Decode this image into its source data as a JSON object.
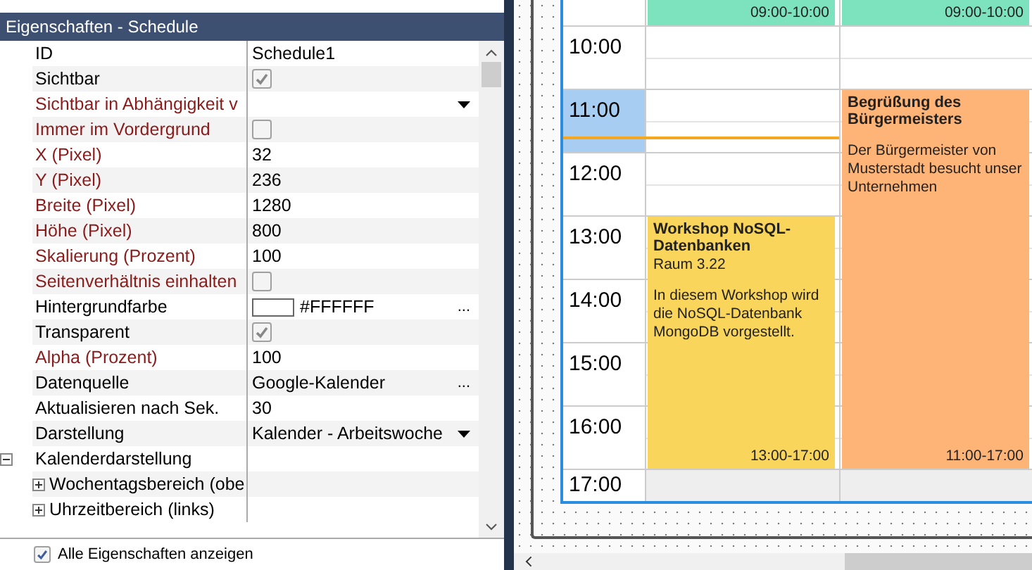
{
  "panel": {
    "title": "Eigenschaften - Schedule",
    "properties": [
      {
        "label": "ID",
        "modified": false,
        "kind": "text",
        "value": "Schedule1"
      },
      {
        "label": "Sichtbar",
        "modified": false,
        "kind": "checkbox",
        "checked": true
      },
      {
        "label": "Sichtbar in Abhängigkeit v",
        "modified": true,
        "kind": "dropdown"
      },
      {
        "label": "Immer im Vordergrund",
        "modified": true,
        "kind": "checkbox",
        "checked": false
      },
      {
        "label": "X (Pixel)",
        "modified": true,
        "kind": "text",
        "value": "32"
      },
      {
        "label": "Y (Pixel)",
        "modified": true,
        "kind": "text",
        "value": "236"
      },
      {
        "label": "Breite (Pixel)",
        "modified": true,
        "kind": "text",
        "value": "1280"
      },
      {
        "label": "Höhe (Pixel)",
        "modified": true,
        "kind": "text",
        "value": "800"
      },
      {
        "label": "Skalierung (Prozent)",
        "modified": true,
        "kind": "text",
        "value": "100"
      },
      {
        "label": "Seitenverhältnis einhalten",
        "modified": true,
        "kind": "checkbox",
        "checked": false
      },
      {
        "label": "Hintergrundfarbe",
        "modified": false,
        "kind": "color",
        "color": "#ffffff",
        "value": "#FFFFFF",
        "button": "..."
      },
      {
        "label": "Transparent",
        "modified": false,
        "kind": "checkbox",
        "checked": true
      },
      {
        "label": "Alpha (Prozent)",
        "modified": true,
        "kind": "text",
        "value": "100"
      },
      {
        "label": "Datenquelle",
        "modified": false,
        "kind": "picker",
        "value": "Google-Kalender",
        "button": "..."
      },
      {
        "label": "Aktualisieren nach Sek.",
        "modified": false,
        "kind": "text",
        "value": "30"
      },
      {
        "label": "Darstellung",
        "modified": false,
        "kind": "dropdown",
        "value": "Kalender - Arbeitswoche"
      },
      {
        "label": "Kalenderdarstellung",
        "modified": false,
        "kind": "group",
        "expanded": true,
        "children": [
          {
            "label": "Wochentagsbereich (obe",
            "modified": false,
            "kind": "group",
            "expanded": false
          },
          {
            "label": "Uhrzeitbereich (links)",
            "modified": false,
            "kind": "group",
            "expanded": false
          }
        ]
      }
    ]
  },
  "show_all": {
    "label": "Alle Eigenschaften anzeigen",
    "checked": true
  },
  "calendar": {
    "hours": [
      {
        "label": "10:00",
        "selected": false,
        "current_time": false
      },
      {
        "label": "11:00",
        "selected": true,
        "current_time": true
      },
      {
        "label": "12:00",
        "selected": false,
        "current_time": false
      },
      {
        "label": "13:00",
        "selected": false,
        "current_time": false
      },
      {
        "label": "14:00",
        "selected": false,
        "current_time": false
      },
      {
        "label": "15:00",
        "selected": false,
        "current_time": false
      },
      {
        "label": "16:00",
        "selected": false,
        "current_time": false
      },
      {
        "label": "17:00",
        "selected": false,
        "current_time": false
      }
    ],
    "columns": [
      {
        "events": [
          {
            "time": "09:00-10:00",
            "color": "#7de3bf"
          },
          {
            "title": "Workshop NoSQL-Datenbanken",
            "location": "Raum 3.22",
            "description": "In diesem Workshop wird die NoSQL-Datenbank MongoDB vorgestellt.",
            "time": "13:00-17:00",
            "color": "#f9d55b"
          }
        ]
      },
      {
        "events": [
          {
            "time": "09:00-10:00",
            "color": "#7de3bf"
          },
          {
            "title": "Begrüßung des Bürgermeisters",
            "description": "Der Bürgermeister von Musterstadt besucht unser Unternehmen",
            "time": "11:00-17:00",
            "color": "#ffb477"
          }
        ]
      }
    ]
  }
}
